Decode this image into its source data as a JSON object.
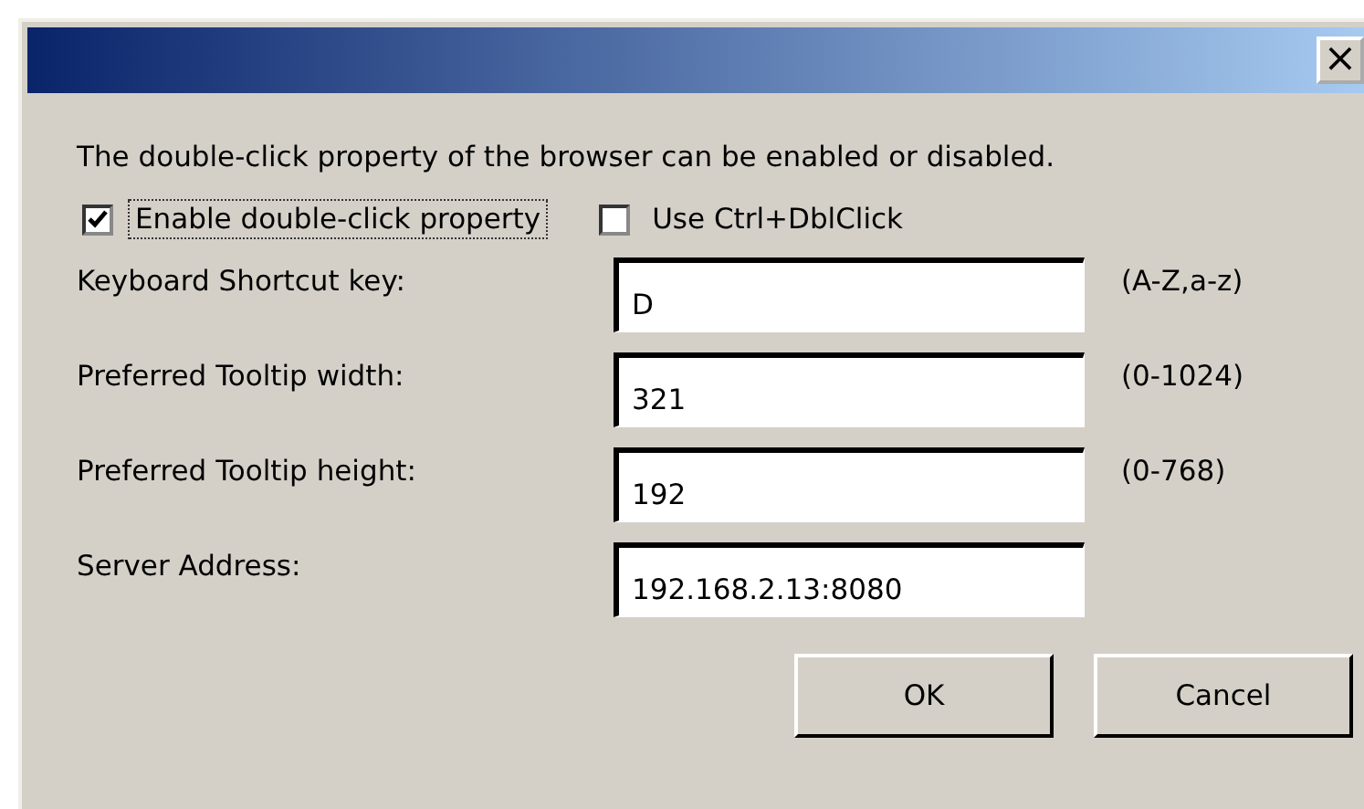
{
  "window": {
    "close_label": "×"
  },
  "description": "The double-click property of the browser can be enabled or disabled.",
  "checkboxes": [
    {
      "label": "Enable double-click property",
      "checked": true,
      "focused": true
    },
    {
      "label": "Use Ctrl+DblClick",
      "checked": false,
      "focused": false
    }
  ],
  "fields": [
    {
      "label": "Keyboard Shortcut key:",
      "value": "D",
      "hint": "(A-Z,a-z)"
    },
    {
      "label": "Preferred Tooltip width:",
      "value": "321",
      "hint": "(0-1024)"
    },
    {
      "label": "Preferred Tooltip height:",
      "value": "192",
      "hint": "(0-768)"
    },
    {
      "label": "Server Address:",
      "value": "192.168.2.13:8080"
    }
  ],
  "buttons": [
    "OK",
    "Cancel"
  ]
}
